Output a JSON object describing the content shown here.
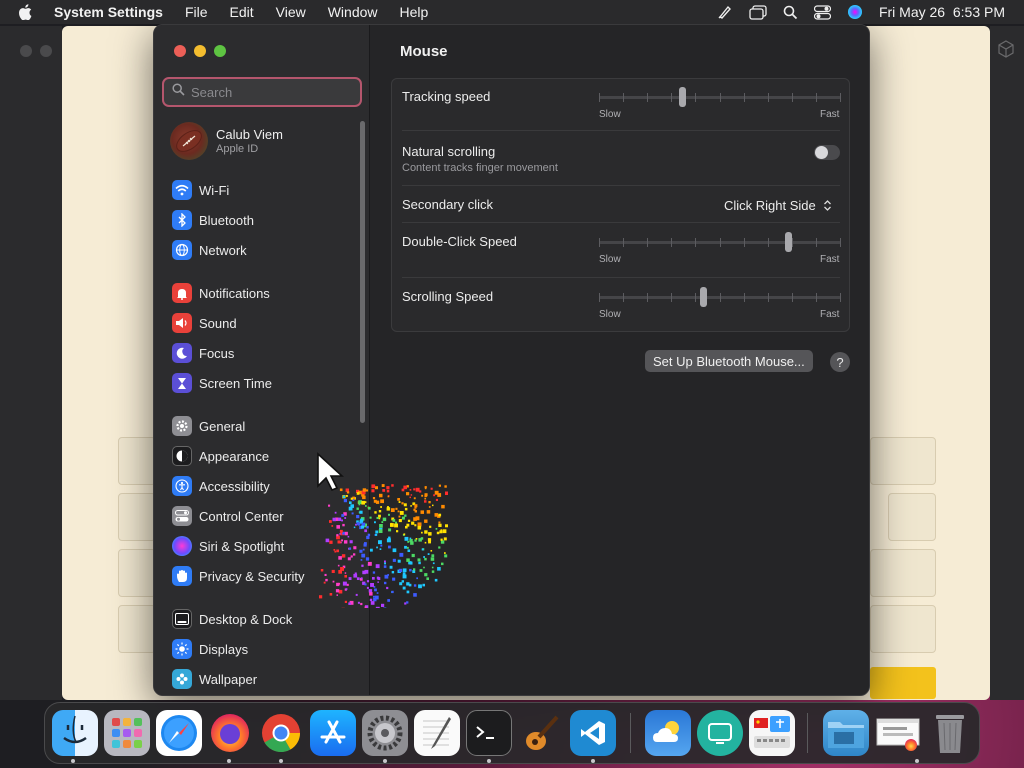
{
  "menubar": {
    "app_name": "System Settings",
    "menus": [
      "File",
      "Edit",
      "View",
      "Window",
      "Help"
    ],
    "clock": "Fri May 26  6:53 PM"
  },
  "sidebar": {
    "search_placeholder": "Search",
    "profile": {
      "name": "Calub Viem",
      "subtitle": "Apple ID"
    },
    "items": [
      {
        "label": "Wi-Fi",
        "color": "#2f7cf6"
      },
      {
        "label": "Bluetooth",
        "color": "#2f7cf6"
      },
      {
        "label": "Network",
        "color": "#2f7cf6"
      },
      {
        "label": "Notifications",
        "color": "#e9413a"
      },
      {
        "label": "Sound",
        "color": "#e9413a"
      },
      {
        "label": "Focus",
        "color": "#5b4fd6"
      },
      {
        "label": "Screen Time",
        "color": "#5b4fd6"
      },
      {
        "label": "General",
        "color": "#8e8e93"
      },
      {
        "label": "Appearance",
        "color": "#1c1c1e"
      },
      {
        "label": "Accessibility",
        "color": "#2f7cf6"
      },
      {
        "label": "Control Center",
        "color": "#8e8e93"
      },
      {
        "label": "Siri & Spotlight",
        "color": "#c03bd6"
      },
      {
        "label": "Privacy & Security",
        "color": "#2f7cf6"
      },
      {
        "label": "Desktop & Dock",
        "color": "#1c1c1e"
      },
      {
        "label": "Displays",
        "color": "#2f7cf6"
      },
      {
        "label": "Wallpaper",
        "color": "#35a8d8"
      }
    ]
  },
  "mouse": {
    "title": "Mouse",
    "tracking_speed": {
      "label": "Tracking speed",
      "min": "Slow",
      "max": "Fast",
      "value": 0.34
    },
    "natural_scrolling": {
      "label": "Natural scrolling",
      "sub": "Content tracks finger movement",
      "on": false
    },
    "secondary_click": {
      "label": "Secondary click",
      "value": "Click Right Side"
    },
    "double_click_speed": {
      "label": "Double-Click Speed",
      "min": "Slow",
      "max": "Fast",
      "value": 0.79
    },
    "scrolling_speed": {
      "label": "Scrolling Speed",
      "min": "Slow",
      "max": "Fast",
      "value": 0.43
    },
    "setup_button": "Set Up Bluetooth Mouse...",
    "help_button": "?"
  },
  "dock": {
    "apps": [
      "Finder",
      "Launchpad",
      "Safari",
      "Firefox",
      "Chrome",
      "App Store",
      "System Settings",
      "TextEdit",
      "Terminal",
      "GarageBand",
      "Visual Studio Code",
      "Weather",
      "Screen Sharing",
      "Input Keyboard",
      "Downloads",
      "Screenshot",
      "Trash"
    ]
  }
}
